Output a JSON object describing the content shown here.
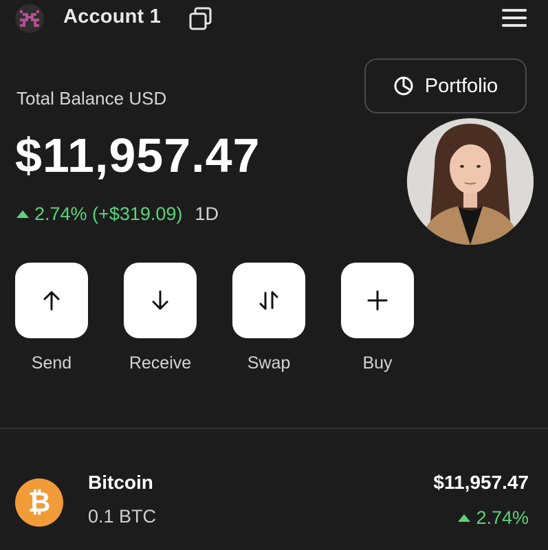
{
  "header": {
    "account_name": "Account 1",
    "avatar_icon": "pixel-avatar-icon",
    "copy_icon": "copy-icon",
    "menu_icon": "hamburger-menu-icon"
  },
  "balance": {
    "label": "Total Balance USD",
    "value": "$11,957.47",
    "change": "2.74% (+$319.09)",
    "period": "1D"
  },
  "portfolio_button": {
    "label": "Portfolio",
    "icon": "pie-chart-icon"
  },
  "actions": [
    {
      "label": "Send",
      "icon": "arrow-up-icon"
    },
    {
      "label": "Receive",
      "icon": "arrow-down-icon"
    },
    {
      "label": "Swap",
      "icon": "swap-icon"
    },
    {
      "label": "Buy",
      "icon": "plus-icon"
    }
  ],
  "assets": [
    {
      "name": "Bitcoin",
      "amount": "0.1 BTC",
      "value": "$11,957.47",
      "change": "2.74%",
      "icon_glyph": "₿"
    }
  ],
  "colors": {
    "background": "#1c1c1c",
    "positive": "#5bd37a",
    "bitcoin": "#f29b39",
    "avatar_pixels": "#b0508f"
  }
}
